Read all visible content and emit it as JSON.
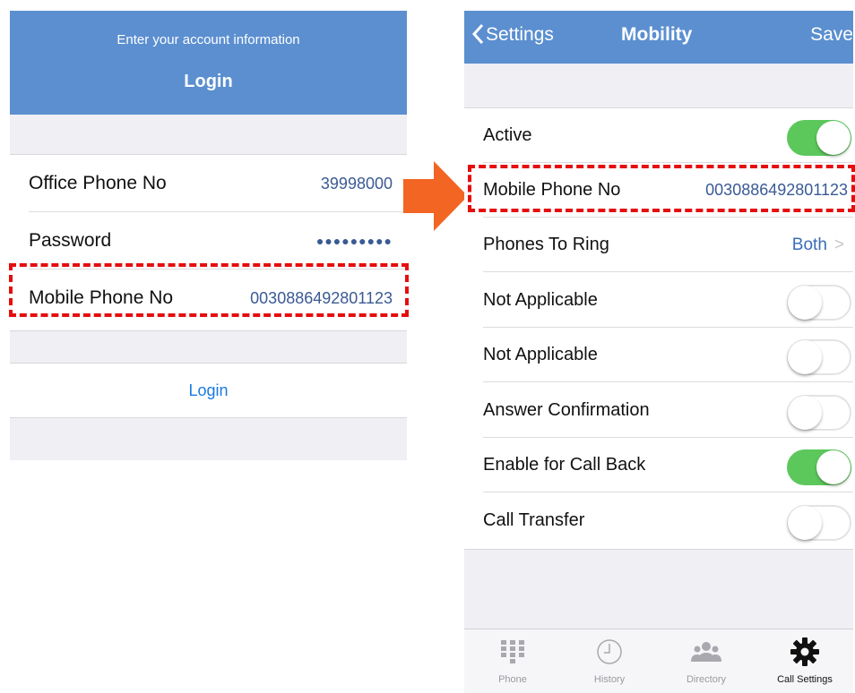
{
  "login": {
    "subtitle": "Enter your account information",
    "title": "Login",
    "fields": [
      {
        "label": "Office Phone No",
        "value": "39998000"
      },
      {
        "label": "Password",
        "value": "●●●●●●●●●"
      },
      {
        "label": "Mobile Phone No",
        "value": "0030886492801123"
      }
    ],
    "login_button": "Login"
  },
  "settings": {
    "nav": {
      "back_label": "Settings",
      "title": "Mobility",
      "save_label": "Save"
    },
    "rows": [
      {
        "label": "Active",
        "type": "toggle",
        "on": true
      },
      {
        "label": "Mobile Phone No",
        "type": "value",
        "value": "0030886492801123"
      },
      {
        "label": "Phones To Ring",
        "type": "link",
        "value": "Both"
      },
      {
        "label": "Not Applicable",
        "type": "toggle",
        "on": false
      },
      {
        "label": "Not Applicable",
        "type": "toggle",
        "on": false
      },
      {
        "label": "Answer Confirmation",
        "type": "toggle",
        "on": false
      },
      {
        "label": "Enable for Call Back",
        "type": "toggle",
        "on": true
      },
      {
        "label": "Call Transfer",
        "type": "toggle",
        "on": false
      }
    ],
    "tabs": [
      {
        "label": "Phone",
        "icon": "keypad-icon",
        "active": false
      },
      {
        "label": "History",
        "icon": "clock-icon",
        "active": false
      },
      {
        "label": "Directory",
        "icon": "people-icon",
        "active": false
      },
      {
        "label": "Call Settings",
        "icon": "gear-icon",
        "active": true
      }
    ]
  },
  "colors": {
    "header": "#5b8fd0",
    "toggle_on": "#5cc85c",
    "highlight": "#e50d0d",
    "arrow": "#f26522"
  }
}
